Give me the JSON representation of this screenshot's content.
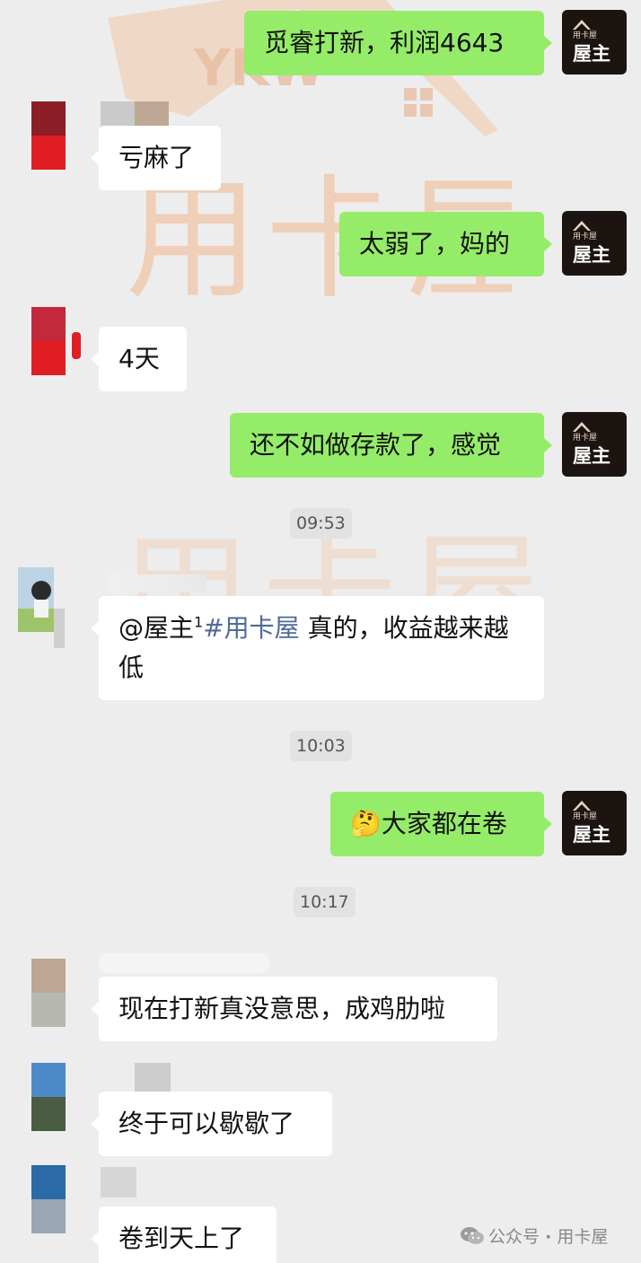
{
  "chat": {
    "watermark": "用卡屋",
    "me_avatar": {
      "small_label": "用卡屋",
      "big_label": "屋主"
    },
    "messages": [
      {
        "text": "觅睿打新，利润4643"
      },
      {
        "text": "亏麻了"
      },
      {
        "text": "太弱了，妈的"
      },
      {
        "text": "4天"
      },
      {
        "text": "还不如做存款了，感觉"
      },
      {
        "time": "09:53"
      },
      {
        "mention_name": "@屋主",
        "mention_sup": "1",
        "mention_tag": "#用卡屋",
        "text": " 真的，收益越来越低"
      },
      {
        "time": "10:03"
      },
      {
        "emoji": "🤔",
        "text": "大家都在卷"
      },
      {
        "time": "10:17"
      },
      {
        "text": "现在打新真没意思，成鸡肋啦"
      },
      {
        "text": "终于可以歇歇了"
      },
      {
        "text": "卷到天上了"
      }
    ]
  },
  "footer": {
    "icon": "wechat-icon",
    "label": "公众号",
    "separator": "·",
    "account": "用卡屋"
  }
}
